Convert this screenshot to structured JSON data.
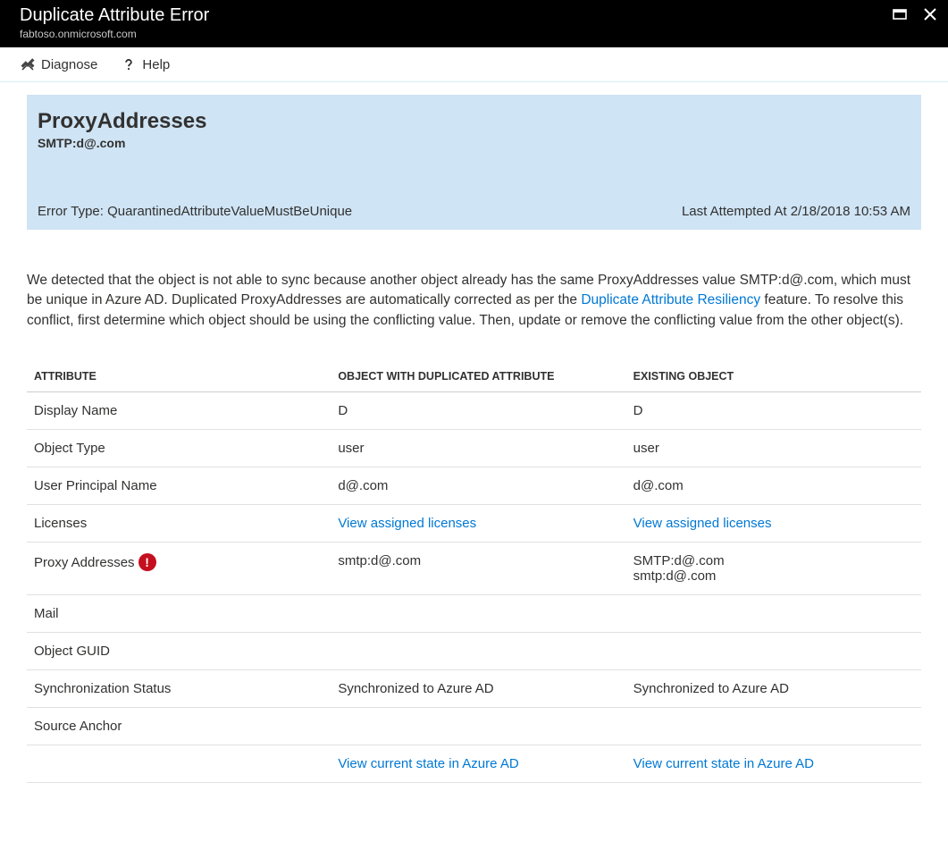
{
  "titlebar": {
    "title": "Duplicate Attribute Error",
    "subtitle": "fabtoso.onmicrosoft.com"
  },
  "toolbar": {
    "diagnose": "Diagnose",
    "help": "Help"
  },
  "banner": {
    "title": "ProxyAddresses",
    "subtitle": "SMTP:d@.com",
    "error_type_label": "Error Type: ",
    "error_type": "QuarantinedAttributeValueMustBeUnique",
    "last_attempted_label": "Last Attempted At ",
    "last_attempted": "2/18/2018 10:53 AM"
  },
  "description": {
    "part1": "We detected that the object is not able to sync because another object already has the same ProxyAddresses value SMTP:d@.com,                     which must be unique in Azure AD. Duplicated ProxyAddresses are automatically corrected as per the ",
    "link": "Duplicate Attribute Resiliency",
    "part2": " feature. To resolve this conflict, first determine which object should be using the conflicting value. Then, update or remove the conflicting value from the other object(s)."
  },
  "table": {
    "headers": {
      "attribute": "ATTRIBUTE",
      "duplicated": "OBJECT WITH DUPLICATED ATTRIBUTE",
      "existing": "EXISTING OBJECT"
    },
    "rows": [
      {
        "attr": "Display Name",
        "dup": "D",
        "exist": "D"
      },
      {
        "attr": "Object Type",
        "dup": "user",
        "exist": "user"
      },
      {
        "attr": "User Principal Name",
        "dup": "d@.com",
        "exist": "d@.com"
      },
      {
        "attr": "Licenses",
        "dup_link": "View assigned licenses",
        "exist_link": "View assigned licenses"
      },
      {
        "attr": "Proxy Addresses",
        "warn": true,
        "dup": "smtp:d@.com",
        "exist": "SMTP:d@.com\nsmtp:d@.com"
      },
      {
        "attr": "Mail",
        "dup": "",
        "exist": ""
      },
      {
        "attr": "Object GUID",
        "dup": "",
        "exist": ""
      },
      {
        "attr": "Synchronization Status",
        "dup": "Synchronized to Azure AD",
        "exist": "Synchronized to Azure AD"
      },
      {
        "attr": "Source Anchor",
        "dup": "",
        "exist": ""
      },
      {
        "attr": "",
        "dup_link": "View current state in Azure AD",
        "exist_link": "View current state in Azure AD"
      }
    ]
  }
}
